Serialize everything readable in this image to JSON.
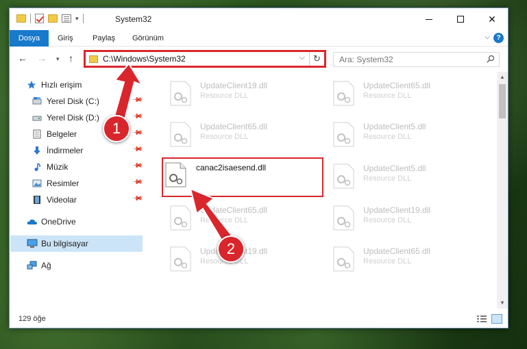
{
  "window": {
    "title": "System32",
    "ribbon_tabs": [
      "Dosya",
      "Giriş",
      "Paylaş",
      "Görünüm"
    ]
  },
  "address_bar": {
    "path": "C:\\Windows\\System32"
  },
  "search": {
    "placeholder": "Ara: System32"
  },
  "sidebar": {
    "items": [
      {
        "label": "Hızlı erişim",
        "icon": "star-icon"
      },
      {
        "label": "Yerel Disk (C:)",
        "icon": "drive-icon",
        "pinned": true
      },
      {
        "label": "Yerel Disk (D:)",
        "icon": "drive-icon",
        "pinned": true
      },
      {
        "label": "Belgeler",
        "icon": "documents-icon",
        "pinned": true
      },
      {
        "label": "İndirmeler",
        "icon": "download-icon",
        "pinned": true
      },
      {
        "label": "Müzik",
        "icon": "music-icon",
        "pinned": true
      },
      {
        "label": "Resimler",
        "icon": "pictures-icon",
        "pinned": true
      },
      {
        "label": "Videolar",
        "icon": "videos-icon",
        "pinned": true
      },
      {
        "label": "OneDrive",
        "icon": "cloud-icon"
      },
      {
        "label": "Bu bilgisayar",
        "icon": "computer-icon",
        "selected": true
      },
      {
        "label": "Ağ",
        "icon": "network-icon"
      }
    ]
  },
  "files": {
    "left_column": [
      {
        "name": "UpdateClient19.dll",
        "type": "Resource DLL"
      },
      {
        "name": "UpdateClient65.dll",
        "type": "Resource DLL"
      },
      {
        "name": "canac2isaesend.dll",
        "type": "",
        "highlighted": true
      },
      {
        "name": "UpdateClient65.dll",
        "type": "Resource DLL"
      },
      {
        "name": "UpdateClient19.dll",
        "type": "Resource DLL"
      }
    ],
    "right_column": [
      {
        "name": "UpdateClient65.dll",
        "type": "Resource DLL"
      },
      {
        "name": "UpdateClient5.dll",
        "type": "Resource DLL"
      },
      {
        "name": "UpdateClient5.dll",
        "type": "Resource DLL"
      },
      {
        "name": "UpdateClient19.dll",
        "type": "Resource DLL"
      },
      {
        "name": "UpdateClient65.dll",
        "type": "Resource DLL"
      }
    ]
  },
  "status": {
    "count": "129 öğe"
  },
  "badges": {
    "one": "1",
    "two": "2"
  },
  "colors": {
    "accent": "#1979ca",
    "annotation_red": "#d9262c",
    "selection": "#cce4f7"
  }
}
